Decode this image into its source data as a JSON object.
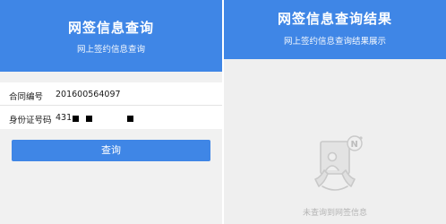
{
  "query_page": {
    "header": {
      "title": "网签信息查询",
      "subtitle": "网上签约信息查询"
    },
    "form": {
      "contract_label": "合同编号",
      "contract_value": "201600564097",
      "id_label": "身份证号码",
      "id_value_visible": "431"
    },
    "query_button_label": "查询"
  },
  "result_page": {
    "header": {
      "title": "网签信息查询结果",
      "subtitle": "网上签约信息查询结果展示"
    },
    "empty_state": {
      "badge": "N",
      "message": "未查询到网签信息",
      "icon": "no-record-icon"
    }
  },
  "colors": {
    "primary": "#3f86e6",
    "background": "#f1f1f1",
    "muted_text": "#b5b5b5"
  }
}
